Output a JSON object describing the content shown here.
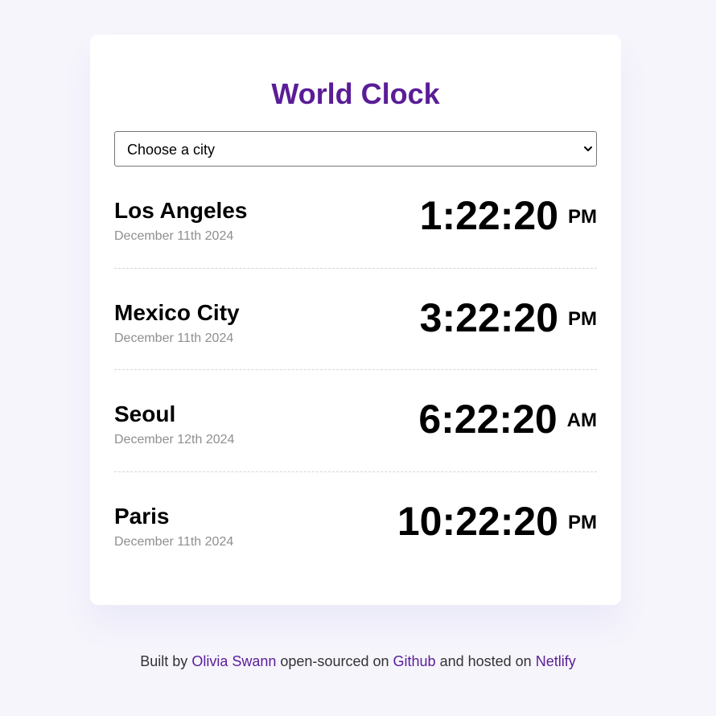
{
  "header": {
    "title": "World Clock"
  },
  "city_select": {
    "selected_label": "Choose a city"
  },
  "cities": [
    {
      "name": "Los Angeles",
      "date": "December 11th 2024",
      "time": "1:22:20",
      "ampm": "PM"
    },
    {
      "name": "Mexico City",
      "date": "December 11th 2024",
      "time": "3:22:20",
      "ampm": "PM"
    },
    {
      "name": "Seoul",
      "date": "December 12th 2024",
      "time": "6:22:20",
      "ampm": "AM"
    },
    {
      "name": "Paris",
      "date": "December 11th 2024",
      "time": "10:22:20",
      "ampm": "PM"
    }
  ],
  "footer": {
    "built_by": "Built by",
    "author": "Olivia Swann",
    "open_sourced": "open-sourced on",
    "github": "Github",
    "hosted": "and hosted on",
    "netlify": "Netlify"
  },
  "colors": {
    "accent": "#5a1d97",
    "background": "#f6f5fc",
    "card": "#ffffff",
    "muted_text": "#8f8f8f"
  }
}
